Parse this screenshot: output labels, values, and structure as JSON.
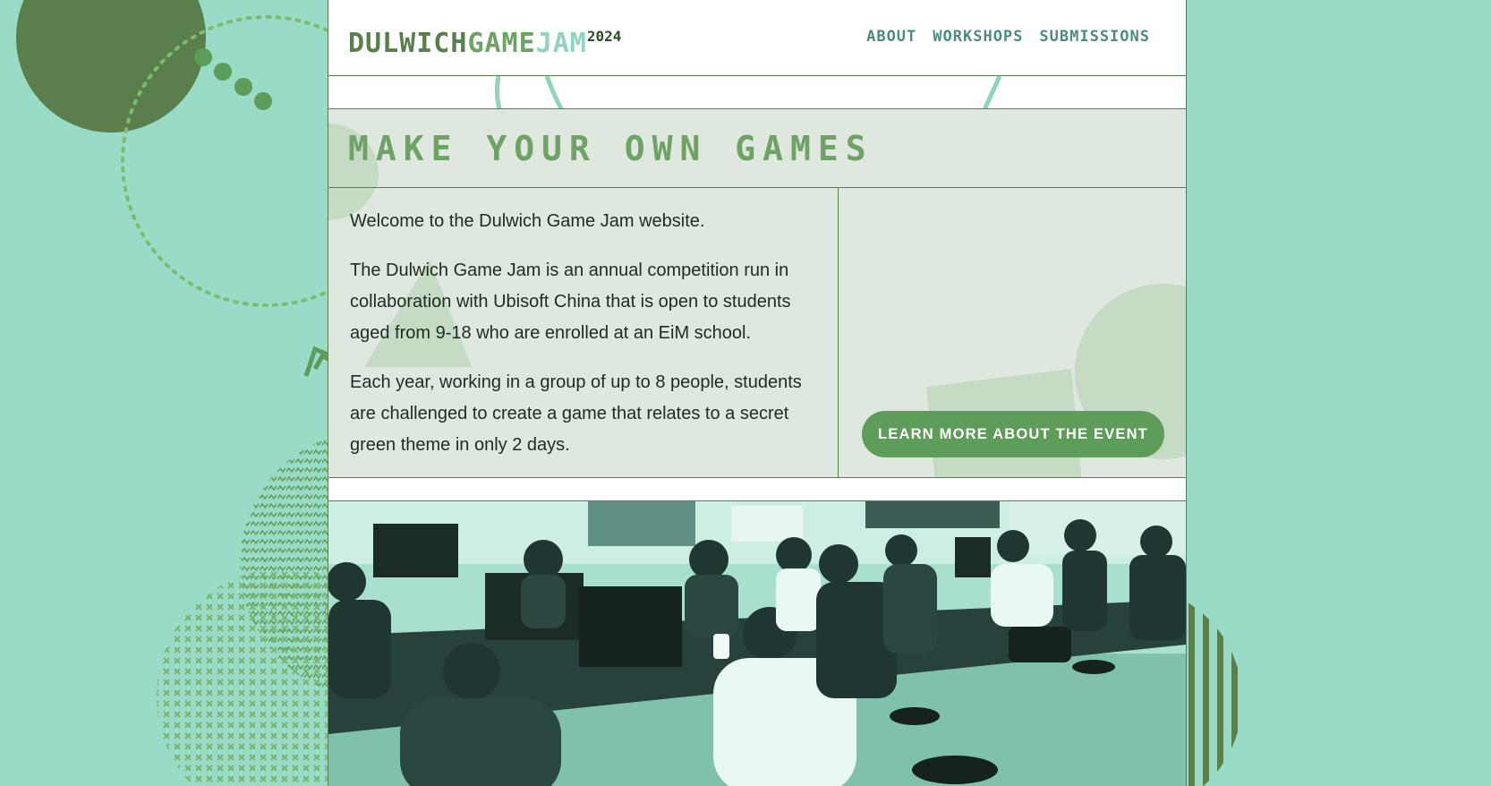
{
  "header": {
    "logo": {
      "part1": "DULWICH",
      "part2": "GAME",
      "part3": "JAM",
      "year": "2024"
    },
    "nav": [
      {
        "label": "ABOUT"
      },
      {
        "label": "WORKSHOPS"
      },
      {
        "label": "SUBMISSIONS"
      }
    ]
  },
  "hero": {
    "title": "MAKE YOUR OWN GAMES"
  },
  "intro": {
    "paragraphs": [
      "Welcome to the Dulwich Game Jam website.",
      "The Dulwich Game Jam is an annual competition run in collaboration with Ubisoft China that is open to students aged from 9-18 who are enrolled at an EiM school.",
      "Each year, working in a group of up to 8 people, students are challenged to create a game that relates to a secret green theme in only 2 days."
    ]
  },
  "cta": {
    "label": "LEARN MORE ABOUT THE EVENT"
  },
  "theme": {
    "background": "#98dbc6",
    "dark_green": "#5a7f4d",
    "mid_green": "#6fa265",
    "mint": "#8fd3c0",
    "panel": "#dfe8df",
    "button": "#5e9c5a"
  }
}
